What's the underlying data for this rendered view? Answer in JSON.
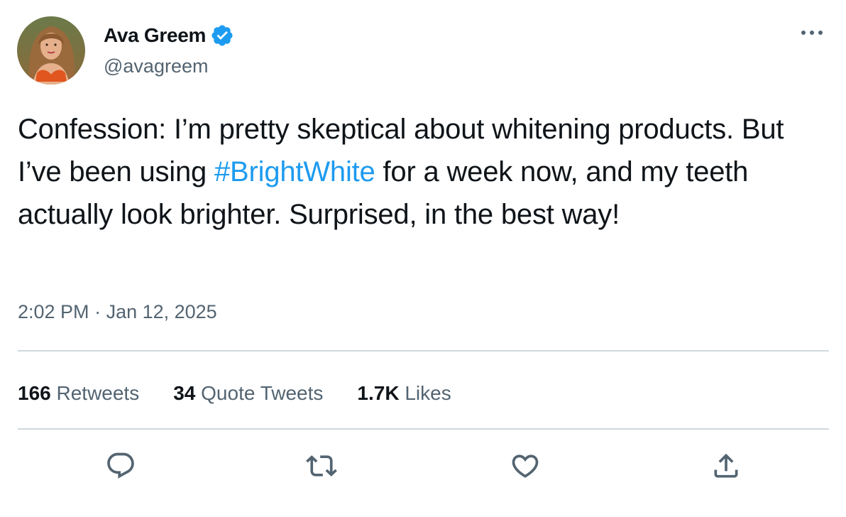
{
  "author": {
    "display_name": "Ava Greem",
    "handle": "@avagreem",
    "verified": true,
    "verified_icon": "verified-badge-icon",
    "avatar_icon": "avatar-photo"
  },
  "tweet": {
    "text_before": "Confession: I’m pretty skeptical about whitening products. But I’ve been using ",
    "hashtag": "#BrightWhite",
    "text_after": " for a week now, and my teeth actually look brighter. Surprised, in the best way!",
    "time": "2:02 PM",
    "separator": " · ",
    "date": "Jan 12, 2025"
  },
  "stats": {
    "retweets_count": "166",
    "retweets_label": " Retweets",
    "quotes_count": "34",
    "quotes_label": " Quote Tweets",
    "likes_count": "1.7K",
    "likes_label": " Likes"
  },
  "actions": {
    "reply_icon": "reply-icon",
    "retweet_icon": "retweet-icon",
    "like_icon": "heart-icon",
    "share_icon": "share-icon",
    "more_icon": "more-options-icon"
  },
  "colors": {
    "text_primary": "#0f1419",
    "text_secondary": "#536471",
    "accent": "#1d9bf0",
    "divider": "#cfd9de"
  }
}
